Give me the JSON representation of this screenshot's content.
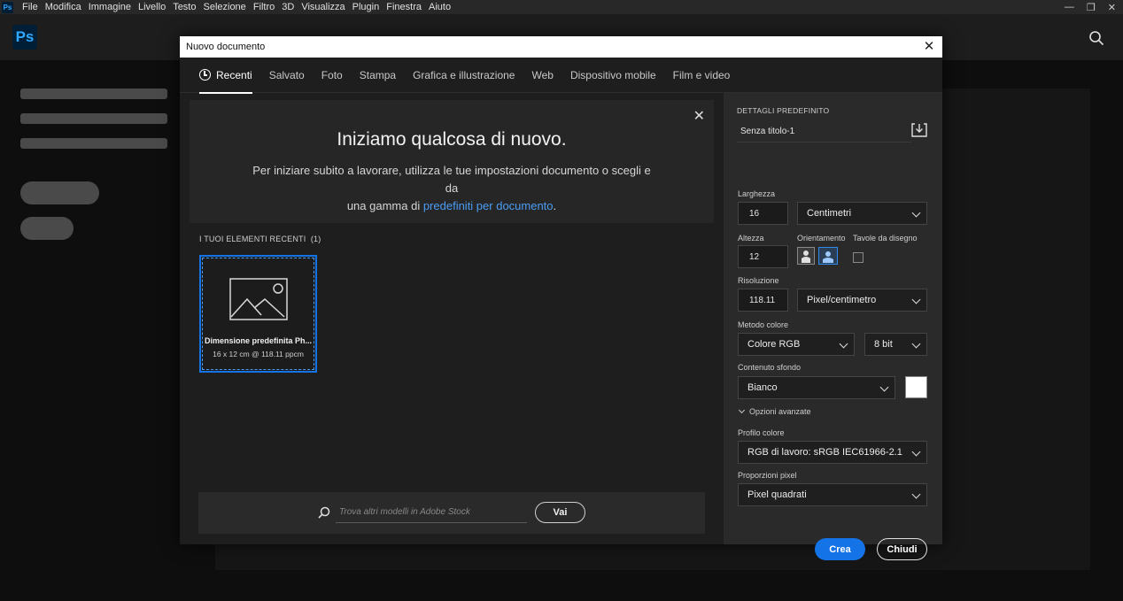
{
  "menubar": {
    "app_icon": "Ps",
    "items": [
      "File",
      "Modifica",
      "Immagine",
      "Livello",
      "Testo",
      "Selezione",
      "Filtro",
      "3D",
      "Visualizza",
      "Plugin",
      "Finestra",
      "Aiuto"
    ],
    "window_controls": [
      "minimize-icon",
      "restore-icon",
      "close-icon"
    ]
  },
  "header": {
    "logo": "Ps",
    "search_icon": "search-icon"
  },
  "dialog": {
    "title": "Nuovo documento",
    "close_icon": "close-icon",
    "tabs": [
      "Recenti",
      "Salvato",
      "Foto",
      "Stampa",
      "Grafica e illustrazione",
      "Web",
      "Dispositivo mobile",
      "Film e video"
    ],
    "active_tab": "Recenti",
    "welcome": {
      "title": "Iniziamo qualcosa di nuovo.",
      "text_before": "Per iniziare subito a lavorare, utilizza le tue impostazioni documento o scegli e da",
      "text_line2_before": "una gamma di ",
      "link": "predefiniti per documento",
      "text_after": "."
    },
    "recent": {
      "header": "I TUOI ELEMENTI RECENTI",
      "count": "(1)",
      "items": [
        {
          "name": "Dimensione predefinita Ph...",
          "info": "16 x 12 cm @ 118.11 ppcm"
        }
      ]
    },
    "stock": {
      "placeholder": "Trova altri modelli in Adobe Stock",
      "button": "Vai"
    },
    "details": {
      "title": "DETTAGLI PREDEFINITO",
      "doc_name": "Senza titolo-1",
      "width_label": "Larghezza",
      "width_value": "16",
      "width_unit": "Centimetri",
      "height_label": "Altezza",
      "height_value": "12",
      "orientation_label": "Orientamento",
      "artboards_label": "Tavole da disegno",
      "resolution_label": "Risoluzione",
      "resolution_value": "118.11",
      "resolution_unit": "Pixel/centimetro",
      "color_mode_label": "Metodo colore",
      "color_mode": "Colore RGB",
      "bit_depth": "8 bit",
      "background_label": "Contenuto sfondo",
      "background": "Bianco",
      "background_color": "#ffffff",
      "advanced": "Opzioni avanzate",
      "profile_label": "Profilo colore",
      "profile": "RGB di lavoro: sRGB IEC61966-2.1",
      "pixel_aspect_label": "Proporzioni pixel",
      "pixel_aspect": "Pixel quadrati"
    },
    "buttons": {
      "create": "Crea",
      "close": "Chiudi"
    }
  },
  "colors": {
    "accent": "#1473e6",
    "link": "#4b9cf5",
    "dialog_bg": "#1e1e1e",
    "panel_bg": "#2a2a2a"
  }
}
